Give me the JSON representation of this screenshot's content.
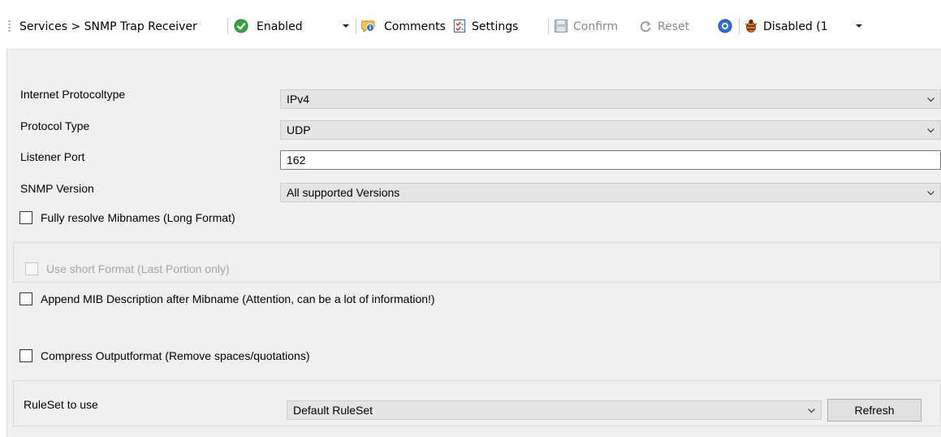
{
  "toolbar": {
    "breadcrumb": "Services > SNMP Trap Receiver",
    "status_value": "Enabled",
    "comments_label": "Comments",
    "settings_label": "Settings",
    "confirm_label": "Confirm",
    "reset_label": "Reset",
    "debug_value": "Disabled (1",
    "colors": {
      "enabled_green": "#3aa53a",
      "help_blue": "#2f6fd6",
      "disabled_text": "#8a8a8a"
    }
  },
  "form": {
    "ip_type": {
      "label": "Internet Protocoltype",
      "value": "IPv4"
    },
    "protocol": {
      "label": "Protocol Type",
      "value": "UDP"
    },
    "port": {
      "label": "Listener Port",
      "value": "162"
    },
    "snmp_version": {
      "label": "SNMP Version",
      "value": "All supported Versions"
    },
    "fully_resolve": {
      "label": "Fully resolve Mibnames (Long Format)",
      "checked": false
    },
    "short_format": {
      "label": "Use short Format (Last Portion only)",
      "checked": false,
      "disabled": true
    },
    "append_mib": {
      "label": "Append MIB Description after Mibname (Attention, can be a lot of information!)",
      "checked": false
    },
    "compress": {
      "label": "Compress Outputformat (Remove spaces/quotations)",
      "checked": false
    },
    "ruleset": {
      "label": "RuleSet to use",
      "value": "Default RuleSet",
      "refresh_label": "Refresh"
    }
  }
}
